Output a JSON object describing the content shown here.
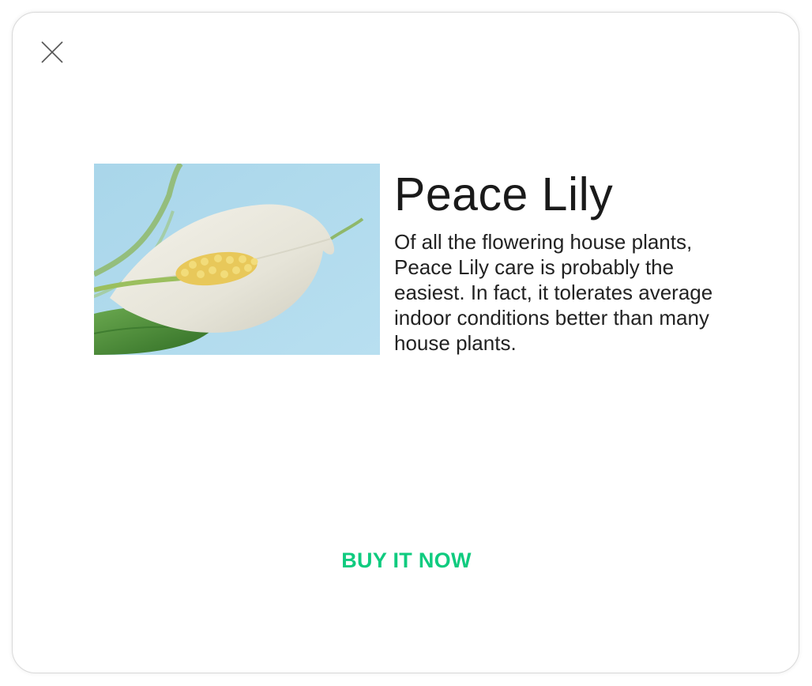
{
  "dialog": {
    "close_icon": "close-icon",
    "product": {
      "title": "Peace Lily",
      "description": "Of all the flowering house plants, Peace Lily care is probably the easiest. In fact, it tolerates average indoor conditions better than many house plants.",
      "image_icon": "peace-lily-photo"
    },
    "buy_label": "BUY IT NOW",
    "colors": {
      "accent": "#0fcb7f",
      "title_text": "#1a1a1a",
      "body_text": "#222222",
      "close_icon": "#555555",
      "border": "#d9d9d9"
    }
  }
}
